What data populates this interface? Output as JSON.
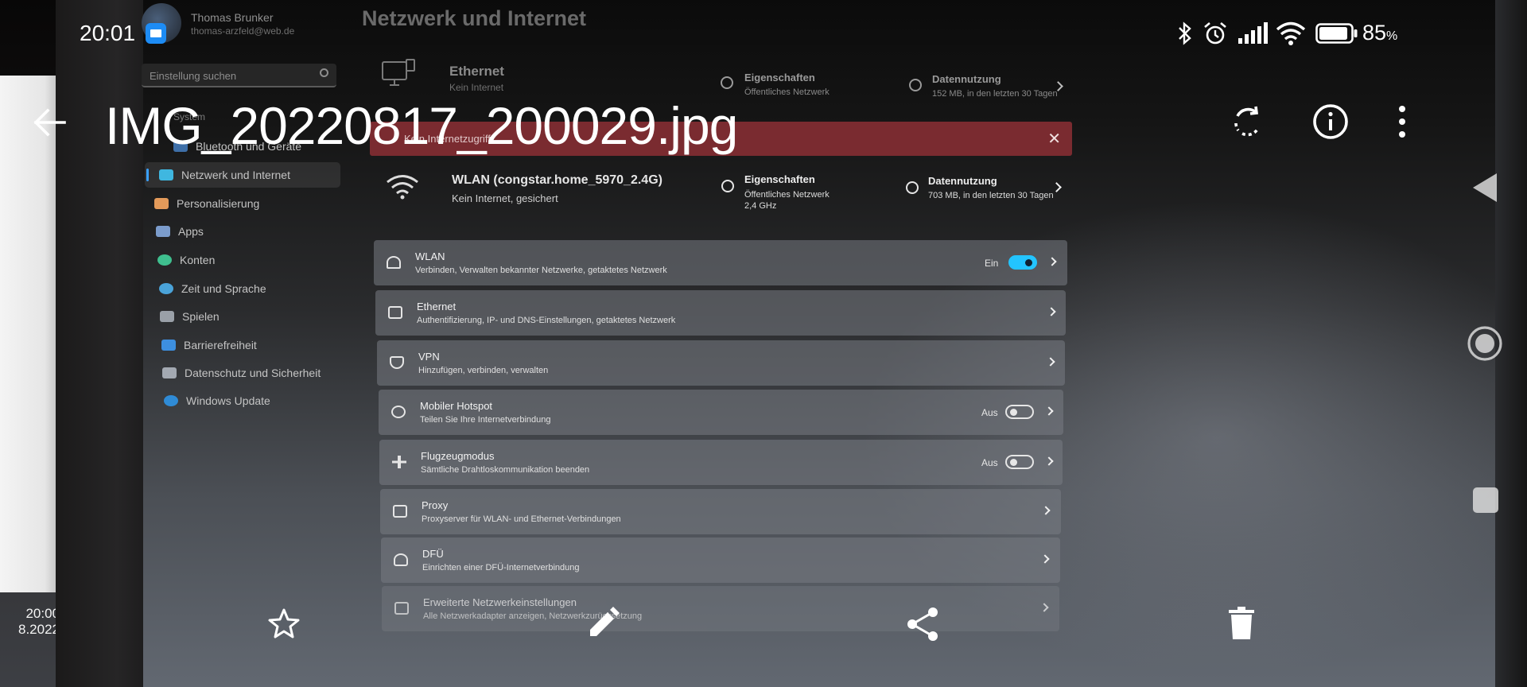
{
  "status_bar": {
    "time": "20:01",
    "battery": "85",
    "battery_unit": "%"
  },
  "app_bar": {
    "title": "IMG_20220817_200029.jpg"
  },
  "photo": {
    "left_clock_time": "20:00",
    "left_clock_date": "8.2022",
    "account": {
      "name": "Thomas Brunker",
      "email": "thomas-arzfeld@web.de"
    },
    "page_heading": "Netzwerk und Internet",
    "search_placeholder": "Einstellung suchen",
    "nav": {
      "system": "System",
      "items": [
        {
          "label": "Bluetooth und Geräte"
        },
        {
          "label": "Netzwerk und Internet"
        },
        {
          "label": "Personalisierung"
        },
        {
          "label": "Apps"
        },
        {
          "label": "Konten"
        },
        {
          "label": "Zeit und Sprache"
        },
        {
          "label": "Spielen"
        },
        {
          "label": "Barrierefreiheit"
        },
        {
          "label": "Datenschutz und Sicherheit"
        },
        {
          "label": "Windows Update"
        }
      ]
    },
    "ethernet": {
      "title": "Ethernet",
      "status": "Kein Internet",
      "props_title": "Eigenschaften",
      "props_sub": "Öffentliches Netzwerk",
      "usage_title": "Datennutzung",
      "usage_sub": "152 MB, in den letzten 30 Tagen"
    },
    "alert": {
      "text": "Kein Internetzugriff"
    },
    "wlan_network": {
      "title": "WLAN (congstar.home_5970_2.4G)",
      "status": "Kein Internet, gesichert",
      "props_title": "Eigenschaften",
      "props_sub1": "Öffentliches Netzwerk",
      "props_sub2": "2,4 GHz",
      "usage_title": "Datennutzung",
      "usage_sub": "703 MB, in den letzten 30 Tagen"
    },
    "cards": [
      {
        "title": "WLAN",
        "subtitle": "Verbinden, Verwalten bekannter Netzwerke, getaktetes Netzwerk",
        "state": "Ein"
      },
      {
        "title": "Ethernet",
        "subtitle": "Authentifizierung, IP- und DNS-Einstellungen, getaktetes Netzwerk"
      },
      {
        "title": "VPN",
        "subtitle": "Hinzufügen, verbinden, verwalten"
      },
      {
        "title": "Mobiler Hotspot",
        "subtitle": "Teilen Sie Ihre Internetverbindung",
        "state": "Aus"
      },
      {
        "title": "Flugzeugmodus",
        "subtitle": "Sämtliche Drahtloskommunikation beenden",
        "state": "Aus"
      },
      {
        "title": "Proxy",
        "subtitle": "Proxyserver für WLAN- und Ethernet-Verbindungen"
      },
      {
        "title": "DFÜ",
        "subtitle": "Einrichten einer DFÜ-Internetverbindung"
      },
      {
        "title": "Erweiterte Netzwerkeinstellungen",
        "subtitle": "Alle Netzwerkadapter anzeigen, Netzwerkzurücksetzung"
      }
    ]
  },
  "icons": {
    "back": "arrow-left-icon",
    "rotate": "rotate-icon",
    "info": "info-icon",
    "more": "more-vertical-icon",
    "favorite": "star-icon",
    "edit": "pencil-icon",
    "share": "share-icon",
    "delete": "trash-icon"
  }
}
